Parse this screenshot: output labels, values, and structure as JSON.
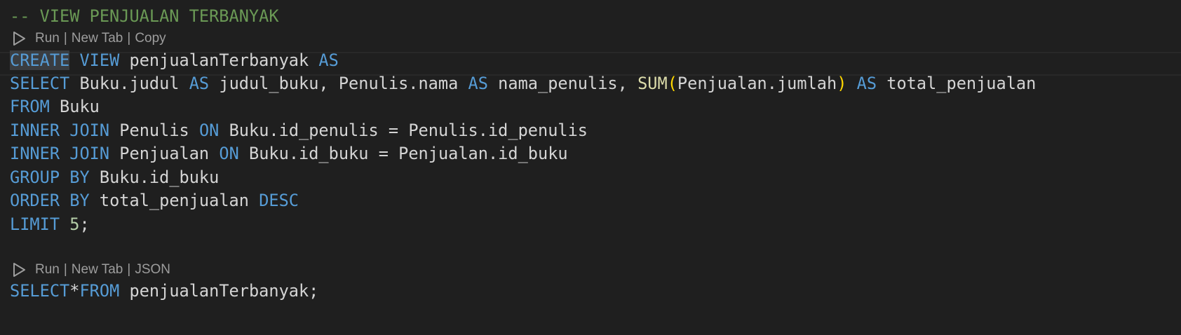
{
  "comment": "-- VIEW PENJUALAN TERBANYAK",
  "codelens_1": {
    "run": "Run",
    "new_tab": "New Tab",
    "action": "Copy",
    "sep": "|"
  },
  "codelens_2": {
    "run": "Run",
    "new_tab": "New Tab",
    "action": "JSON",
    "sep": "|"
  },
  "tokens": {
    "create": "CREATE",
    "view": "VIEW",
    "view_name": "penjualanTerbanyak",
    "as": "AS",
    "select": "SELECT",
    "buku_judul": "Buku.judul",
    "judul_buku": "judul_buku,",
    "penulis_nama": "Penulis.nama",
    "nama_penulis": "nama_penulis,",
    "sum": "SUM",
    "lparen": "(",
    "penjualan_jumlah": "Penjualan.jumlah",
    "rparen": ")",
    "total_penjualan": "total_penjualan",
    "from": "FROM",
    "buku": "Buku",
    "inner": "INNER",
    "join": "JOIN",
    "penulis": "Penulis",
    "on": "ON",
    "buku_id_penulis": "Buku.id_penulis",
    "eq": "=",
    "penulis_id_penulis": "Penulis.id_penulis",
    "penjualan": "Penjualan",
    "buku_id_buku": "Buku.id_buku",
    "penjualan_id_buku": "Penjualan.id_buku",
    "group": "GROUP",
    "by": "BY",
    "order": "ORDER",
    "desc": "DESC",
    "limit": "LIMIT",
    "limit_value": "5",
    "semicolon": ";",
    "star": "*",
    "select_from_target": "penjualanTerbanyak;"
  },
  "colors": {
    "background": "#1f1f1f",
    "keyword": "#569cd6",
    "identifier": "#d4d4d4",
    "function": "#dcdcaa",
    "bracket": "#ffd700",
    "number": "#b5cea8",
    "comment": "#6a9955",
    "codelens": "#9d9d9d"
  }
}
